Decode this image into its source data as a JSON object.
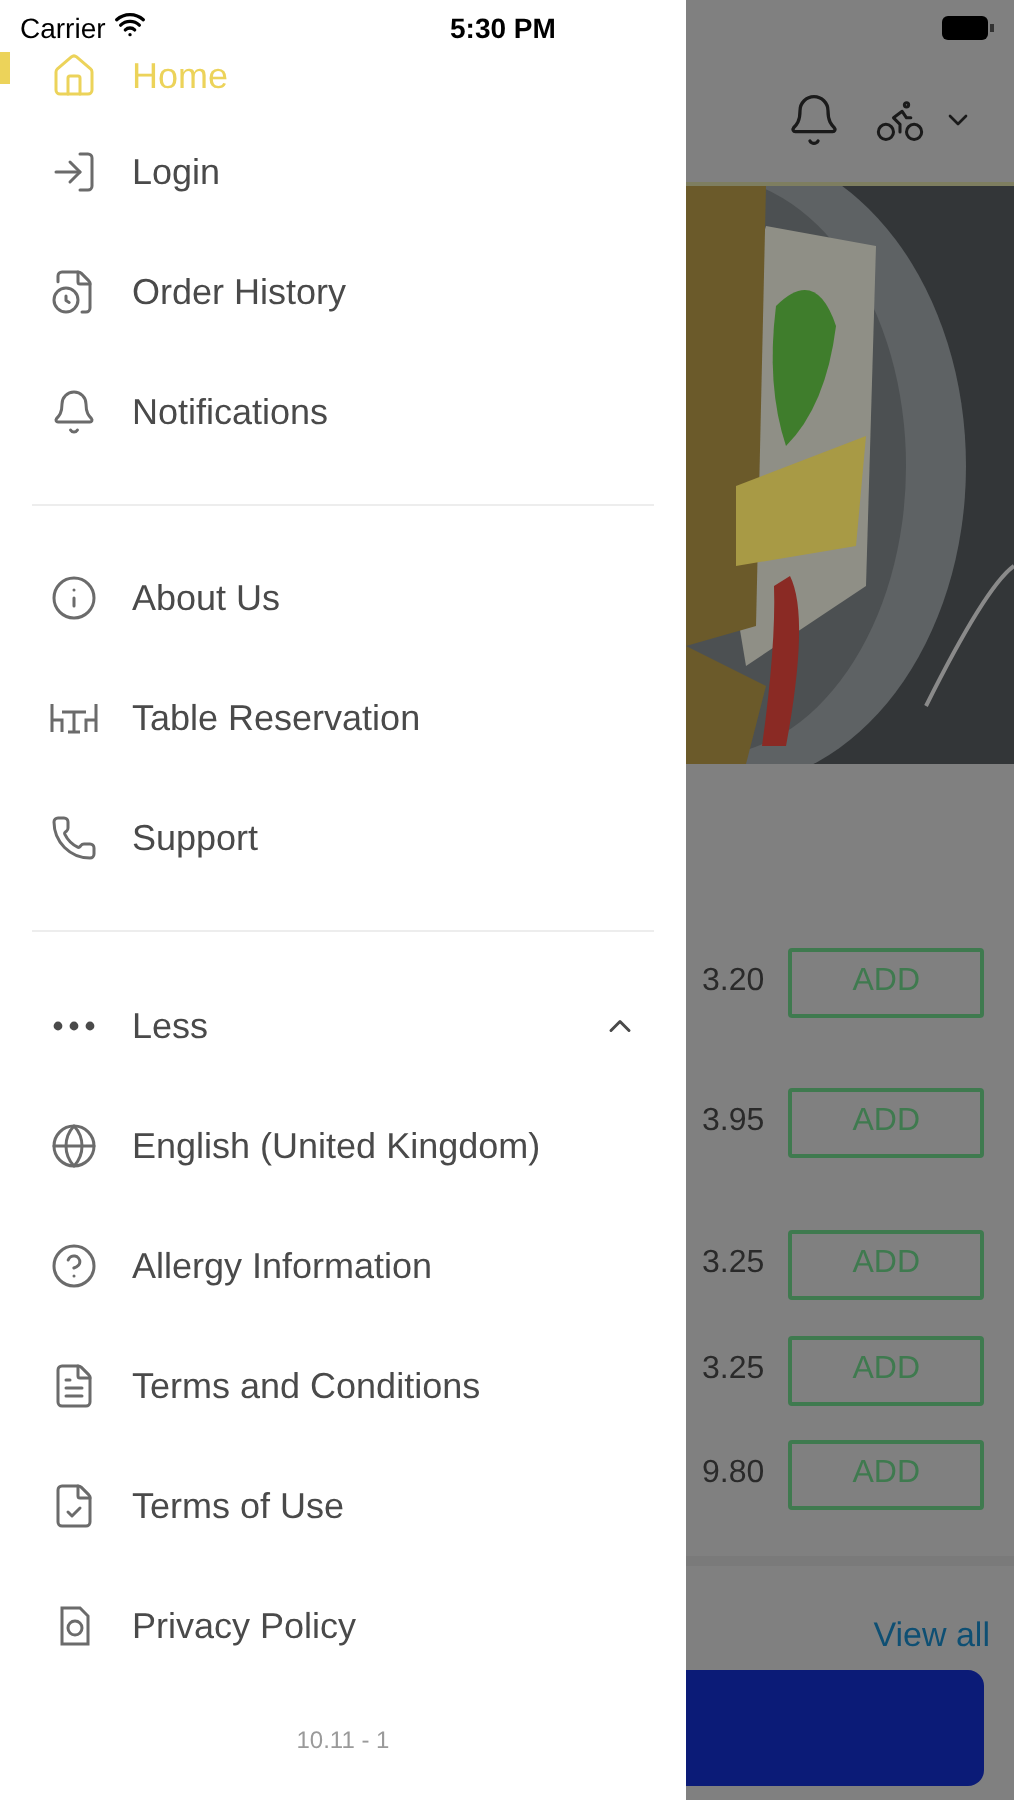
{
  "status_bar": {
    "carrier": "Carrier",
    "time": "5:30 PM"
  },
  "drawer": {
    "sections": [
      {
        "items": [
          {
            "label": "Home",
            "selected": true
          },
          {
            "label": "Login",
            "selected": false
          },
          {
            "label": "Order History",
            "selected": false
          },
          {
            "label": "Notifications",
            "selected": false
          }
        ]
      },
      {
        "items": [
          {
            "label": "About Us",
            "selected": false
          },
          {
            "label": "Table Reservation",
            "selected": false
          },
          {
            "label": "Support",
            "selected": false
          }
        ]
      }
    ],
    "more": {
      "label": "Less",
      "expanded": true,
      "items": [
        {
          "label": "English (United Kingdom)",
          "selected": false
        },
        {
          "label": "Allergy Information",
          "selected": false
        },
        {
          "label": "Terms and Conditions",
          "selected": false
        },
        {
          "label": "Terms of Use",
          "selected": false
        },
        {
          "label": "Privacy Policy",
          "selected": false
        }
      ]
    },
    "version": "10.11 - 1"
  },
  "background": {
    "products": [
      {
        "price": "3.20",
        "button": "ADD"
      },
      {
        "price": "3.95",
        "button": "ADD"
      },
      {
        "price": "3.25",
        "button": "ADD"
      },
      {
        "price": "3.25",
        "button": "ADD"
      },
      {
        "price": "9.80",
        "button": "ADD"
      }
    ],
    "view_all": "View all"
  }
}
